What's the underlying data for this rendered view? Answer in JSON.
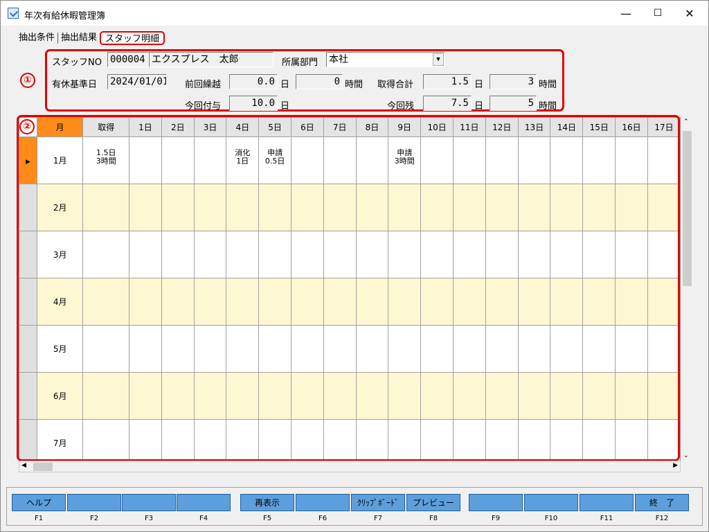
{
  "window": {
    "title": "年次有給休暇管理簿",
    "min": "—",
    "max": "☐",
    "close": "✕"
  },
  "tabs": [
    "抽出条件",
    "抽出結果",
    "スタッフ明細"
  ],
  "markers": {
    "one": "①",
    "two": "②"
  },
  "staff": {
    "no_label": "スタッフNO",
    "no": "000004",
    "name": "エクスプレス　太郎",
    "dept_label": "所属部門",
    "dept": "本社",
    "base_date_label": "有休基準日",
    "base_date": "2024/01/01",
    "prev_carry_label": "前回繰越",
    "prev_carry_days": "0.0",
    "prev_carry_hours": "0",
    "grant_label": "今回付与",
    "grant_days": "10.0",
    "taken_total_label": "取得合計",
    "taken_days": "1.5",
    "taken_hours": "3",
    "remain_label": "今回残",
    "remain_days": "7.5",
    "remain_hours": "5",
    "unit_day": "日",
    "unit_hour": "時間"
  },
  "grid": {
    "headers": [
      "月",
      "取得",
      "1日",
      "2日",
      "3日",
      "4日",
      "5日",
      "6日",
      "7日",
      "8日",
      "9日",
      "10日",
      "11日",
      "12日",
      "13日",
      "14日",
      "15日",
      "16日",
      "17日"
    ],
    "rows": [
      {
        "month": "1月",
        "taken": "1.5日\n3時間",
        "cells": {
          "4日": "消化\n1日",
          "5日": "申請\n0.5日",
          "9日": "申請\n3時間"
        }
      },
      {
        "month": "2月",
        "taken": "",
        "cells": {}
      },
      {
        "month": "3月",
        "taken": "",
        "cells": {}
      },
      {
        "month": "4月",
        "taken": "",
        "cells": {}
      },
      {
        "month": "5月",
        "taken": "",
        "cells": {}
      },
      {
        "month": "6月",
        "taken": "",
        "cells": {}
      },
      {
        "month": "7月",
        "taken": "",
        "cells": {}
      }
    ],
    "current_row_marker": "▶"
  },
  "function_keys": [
    {
      "label": "ヘルプ",
      "key": "F1"
    },
    {
      "label": "",
      "key": "F2"
    },
    {
      "label": "",
      "key": "F3"
    },
    {
      "label": "",
      "key": "F4"
    },
    {
      "label": "再表示",
      "key": "F5"
    },
    {
      "label": "",
      "key": "F6"
    },
    {
      "label": "ｸﾘｯﾌﾟﾎﾞｰﾄﾞ",
      "key": "F7"
    },
    {
      "label": "プレビュー",
      "key": "F8"
    },
    {
      "label": "",
      "key": "F9"
    },
    {
      "label": "",
      "key": "F10"
    },
    {
      "label": "",
      "key": "F11"
    },
    {
      "label": "終　了",
      "key": "F12"
    }
  ],
  "colors": {
    "accent": "#ff8c1a",
    "highlight": "#e00000",
    "alt_row": "#fdf8d2",
    "fn_button": "#5d9fdc"
  }
}
